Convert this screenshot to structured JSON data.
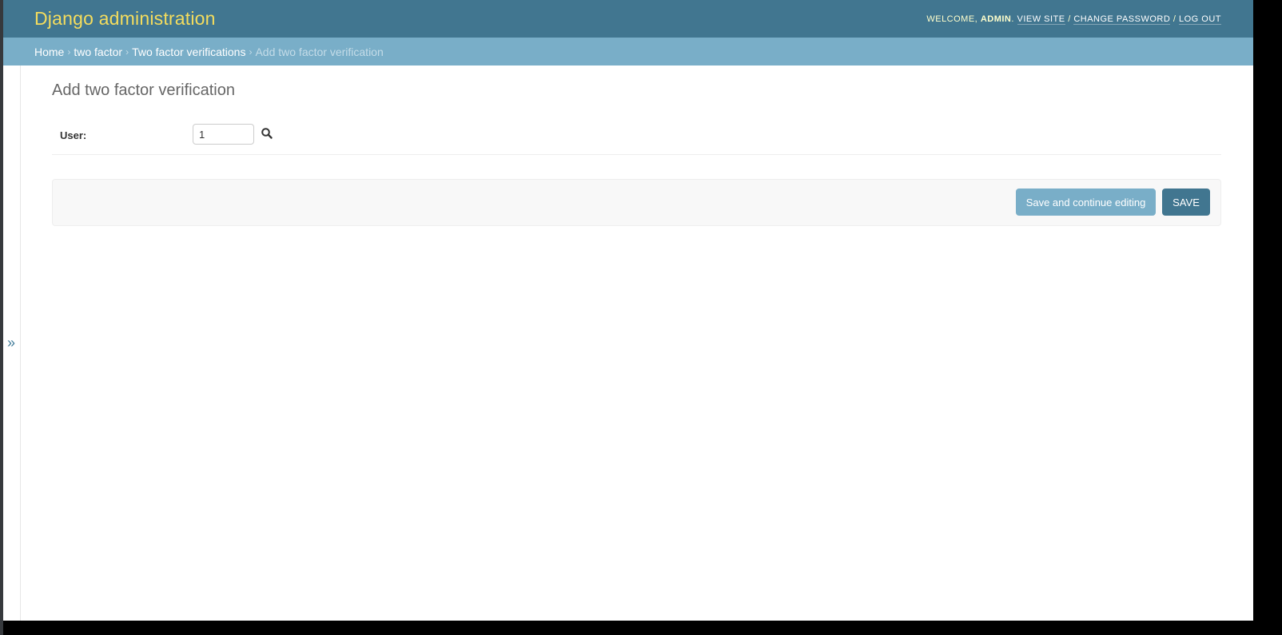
{
  "header": {
    "site_name": "Django administration",
    "welcome": "Welcome,",
    "username": "admin",
    "links": {
      "view_site": "View site",
      "change_password": "Change password",
      "log_out": "Log out"
    },
    "separator": "/"
  },
  "breadcrumbs": {
    "items": [
      "Home",
      "two factor",
      "Two factor verifications"
    ],
    "current": "Add two factor verification",
    "separator": "›"
  },
  "sidebar_toggle": {
    "icon": "»"
  },
  "main": {
    "title": "Add two factor verification",
    "fields": [
      {
        "label": "User:",
        "value": "1",
        "lookup_icon": "search-icon"
      }
    ],
    "buttons": {
      "save_continue": "Save and continue editing",
      "save": "Save"
    }
  },
  "colors": {
    "header_bg": "#417690",
    "breadcrumbs_bg": "#79aec8",
    "site_name": "#f5dd5d",
    "button_primary": "#417690",
    "button_secondary": "#79aec8"
  }
}
